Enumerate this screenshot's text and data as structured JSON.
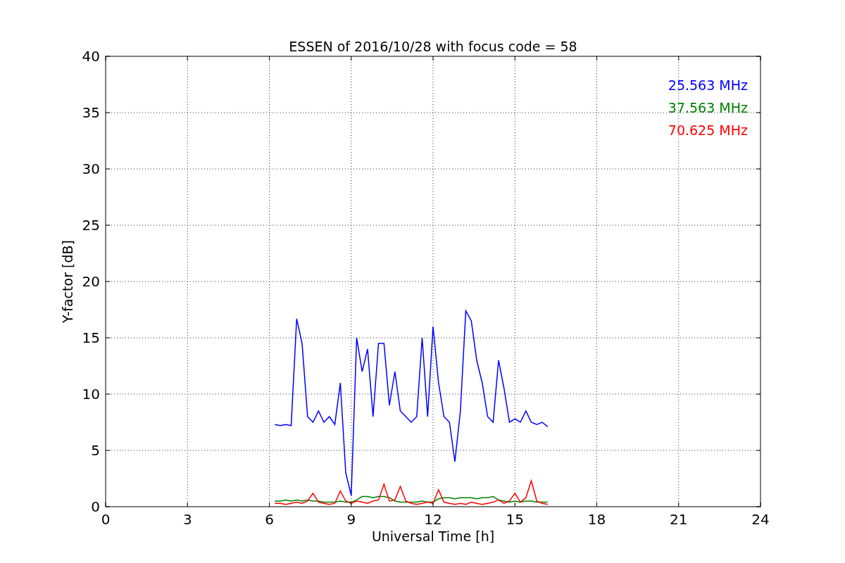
{
  "chart_data": {
    "type": "line",
    "title": "ESSEN of 2016/10/28 with focus code = 58",
    "xlabel": "Universal Time [h]",
    "ylabel": "Y-factor [dB]",
    "x": [
      6.2,
      6.4,
      6.6,
      6.8,
      7.0,
      7.2,
      7.4,
      7.6,
      7.8,
      8.0,
      8.2,
      8.4,
      8.6,
      8.8,
      9.0,
      9.2,
      9.4,
      9.6,
      9.8,
      10.0,
      10.2,
      10.4,
      10.6,
      10.8,
      11.0,
      11.2,
      11.4,
      11.6,
      11.8,
      12.0,
      12.2,
      12.4,
      12.6,
      12.8,
      13.0,
      13.2,
      13.4,
      13.6,
      13.8,
      14.0,
      14.2,
      14.4,
      14.6,
      14.8,
      15.0,
      15.2,
      15.4,
      15.6,
      15.8,
      16.0,
      16.2
    ],
    "series": [
      {
        "name": "25.563 MHz",
        "color": "#0000ff",
        "values": [
          7.3,
          7.2,
          7.3,
          7.2,
          16.7,
          14.5,
          8.0,
          7.5,
          8.5,
          7.5,
          8.0,
          7.3,
          11.0,
          3.0,
          1.0,
          15.0,
          12.0,
          14.0,
          8.0,
          14.5,
          14.5,
          9.0,
          12.0,
          8.5,
          8.0,
          7.5,
          8.0,
          15.0,
          8.0,
          16.0,
          11.0,
          8.0,
          7.5,
          4.0,
          8.5,
          17.4,
          16.5,
          13.0,
          11.0,
          8.0,
          7.5,
          13.0,
          10.5,
          7.5,
          7.8,
          7.5,
          8.5,
          7.5,
          7.3,
          7.5,
          7.1
        ]
      },
      {
        "name": "37.563 MHz",
        "color": "#008000",
        "values": [
          0.5,
          0.5,
          0.6,
          0.5,
          0.6,
          0.5,
          0.6,
          0.5,
          0.5,
          0.4,
          0.4,
          0.4,
          0.5,
          0.4,
          0.4,
          0.6,
          0.9,
          0.9,
          0.8,
          0.9,
          0.9,
          0.8,
          0.5,
          0.4,
          0.4,
          0.4,
          0.4,
          0.5,
          0.4,
          0.4,
          0.7,
          0.8,
          0.8,
          0.7,
          0.8,
          0.8,
          0.8,
          0.7,
          0.8,
          0.8,
          0.9,
          0.6,
          0.5,
          0.4,
          0.5,
          0.4,
          0.5,
          0.5,
          0.4,
          0.4,
          0.4
        ]
      },
      {
        "name": "70.625 MHz",
        "color": "#ff0000",
        "values": [
          0.3,
          0.3,
          0.2,
          0.3,
          0.4,
          0.3,
          0.5,
          1.2,
          0.4,
          0.3,
          0.2,
          0.3,
          1.4,
          0.5,
          0.3,
          0.5,
          0.4,
          0.3,
          0.5,
          0.6,
          2.0,
          0.5,
          0.6,
          1.8,
          0.5,
          0.3,
          0.2,
          0.3,
          0.4,
          0.3,
          1.5,
          0.4,
          0.3,
          0.2,
          0.3,
          0.2,
          0.4,
          0.3,
          0.2,
          0.3,
          0.4,
          0.6,
          0.3,
          0.5,
          1.2,
          0.4,
          0.8,
          2.3,
          0.5,
          0.3,
          0.2
        ]
      }
    ],
    "xlim": [
      0,
      24
    ],
    "ylim": [
      0,
      40
    ],
    "xticks": [
      0,
      3,
      6,
      9,
      12,
      15,
      18,
      21,
      24
    ],
    "yticks": [
      0,
      5,
      10,
      15,
      20,
      25,
      30,
      35,
      40
    ],
    "grid": true
  }
}
